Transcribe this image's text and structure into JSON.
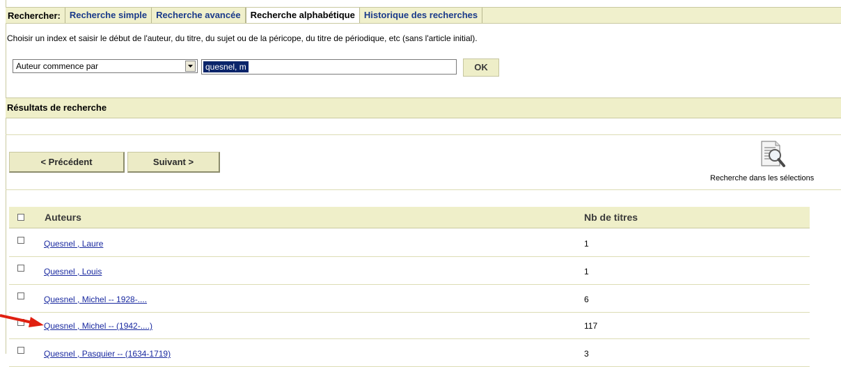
{
  "search_tabs": {
    "label": "Rechercher:",
    "items": [
      {
        "label": "Recherche simple",
        "active": false
      },
      {
        "label": "Recherche avancée",
        "active": false
      },
      {
        "label": "Recherche alphabétique",
        "active": true
      },
      {
        "label": "Historique des recherches",
        "active": false
      }
    ]
  },
  "instructions": "Choisir un index et saisir le début de l'auteur, du titre, du sujet ou de la péricope, du titre de périodique, etc (sans l'article initial).",
  "search_form": {
    "index_selected": "Auteur commence par",
    "query_value": "quesnel, m",
    "submit_label": "OK"
  },
  "results": {
    "header": "Résultats de recherche",
    "prev_label": "< Précédent",
    "next_label": "Suivant >",
    "selection_search_label": "Recherche dans les sélections",
    "columns": {
      "authors": "Auteurs",
      "count": "Nb de titres"
    },
    "rows": [
      {
        "author": "Quesnel , Laure",
        "count": "1"
      },
      {
        "author": "Quesnel , Louis",
        "count": "1"
      },
      {
        "author": "Quesnel , Michel -- 1928-....",
        "count": "6"
      },
      {
        "author": "Quesnel , Michel -- (1942-....)",
        "count": "117"
      },
      {
        "author": "Quesnel , Pasquier -- (1634-1719)",
        "count": "3"
      }
    ]
  },
  "colors": {
    "band_bg": "#efefc9",
    "link": "#1a2aa0",
    "tab_text": "#1a3a8a",
    "annotation_arrow": "#e02010"
  }
}
